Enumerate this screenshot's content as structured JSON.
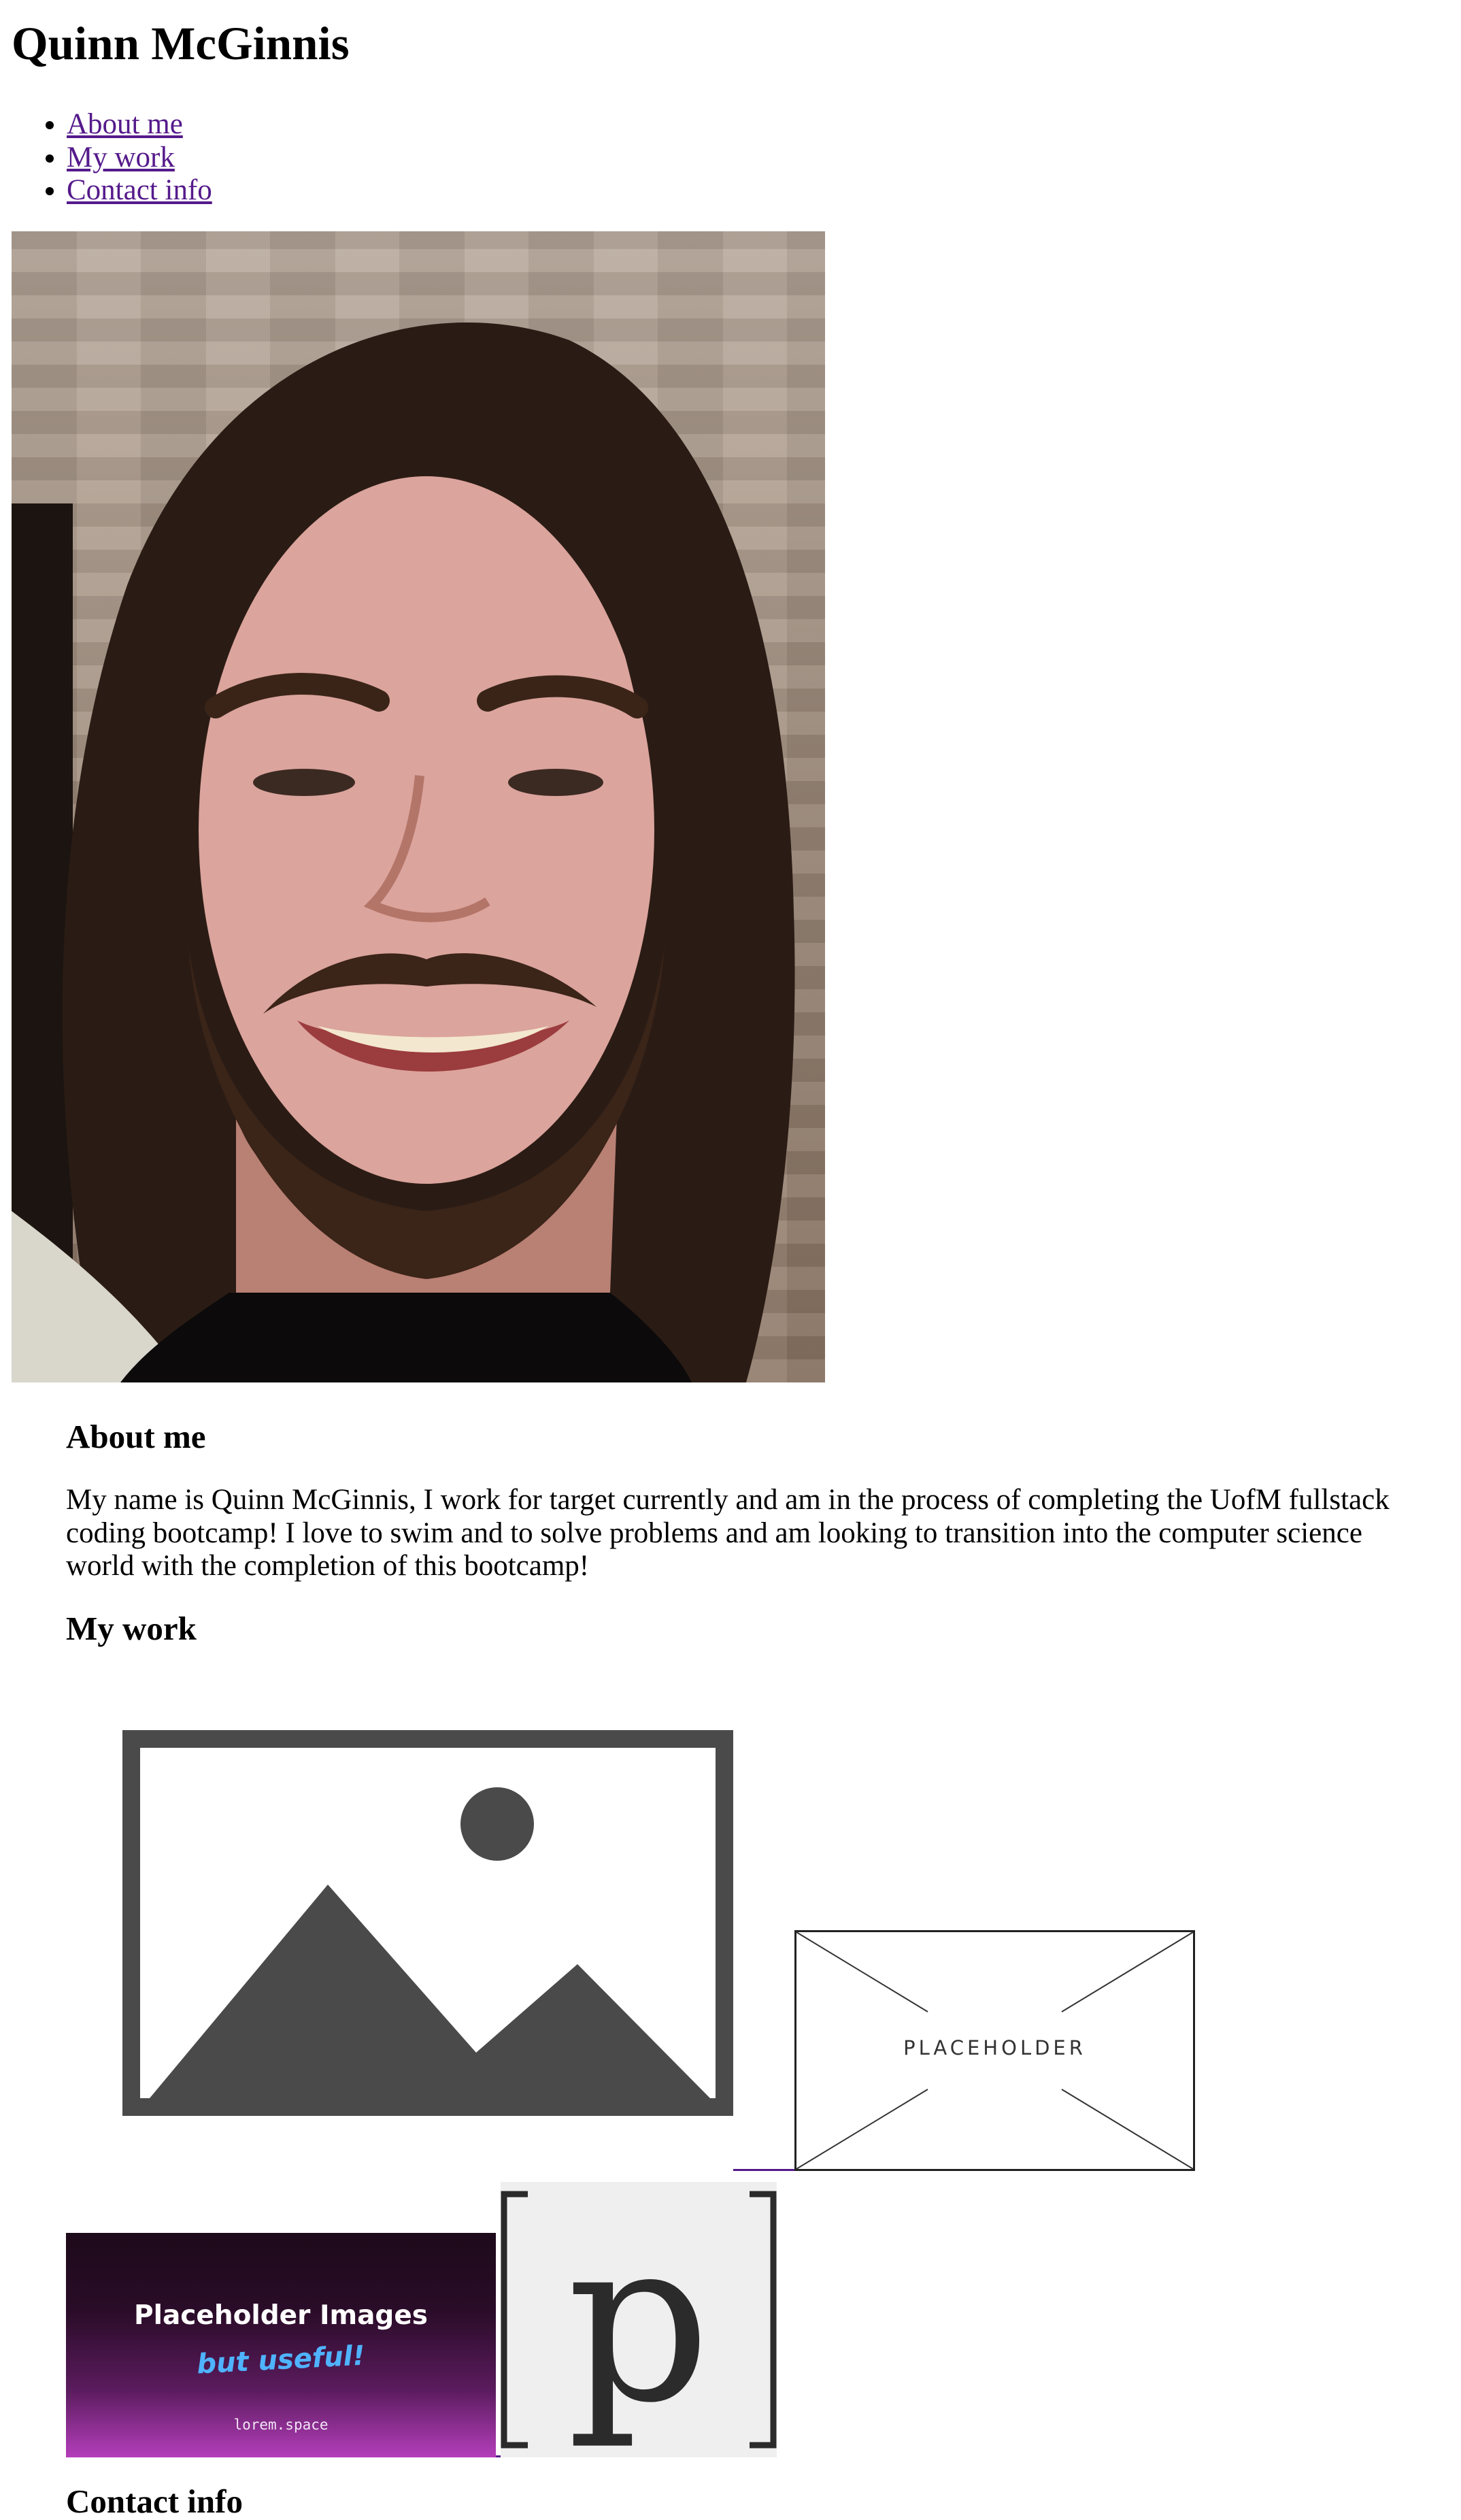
{
  "header": {
    "title": "Quinn McGinnis"
  },
  "nav": {
    "items": [
      {
        "label": "About me"
      },
      {
        "label": "My work"
      },
      {
        "label": "Contact info"
      }
    ]
  },
  "about": {
    "heading": "About me",
    "text": "My name is Quinn McGinnis, I work for target currently and am in the process of completing the UofM fullstack coding bootcamp! I love to swim and to solve problems and am looking to transition into the computer science world with the completion of this bootcamp!"
  },
  "work": {
    "heading": "My work",
    "envelope_label": "PLACEHOLDER",
    "lorem_title": "Placeholder Images",
    "lorem_tagline": "but useful!",
    "lorem_domain": "lorem.space",
    "p_glyph": "p"
  },
  "contact": {
    "heading": "Contact info"
  },
  "colors": {
    "link": "#551a8b",
    "placeholder_gray": "#4a4a4a"
  }
}
